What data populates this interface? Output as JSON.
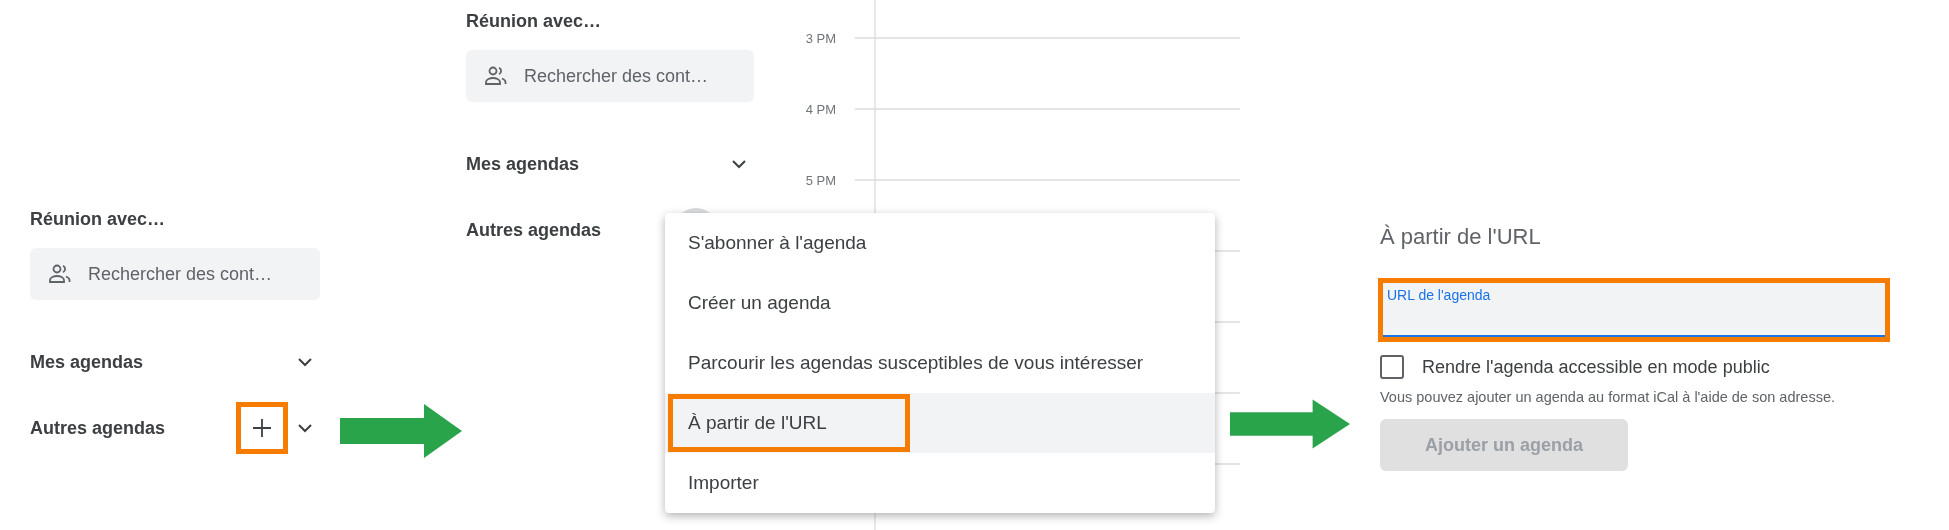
{
  "panel_1": {
    "section_title": "Réunion avec…",
    "search": {
      "placeholder": "Rechercher des cont…"
    },
    "calendar_groups": [
      {
        "label": "Mes agendas",
        "chevron": true
      },
      {
        "label": "Autres agendas",
        "chevron": true,
        "add_button": {
          "kind": "plus",
          "highlighted": true
        }
      }
    ]
  },
  "panel_2": {
    "section_title": "Réunion avec…",
    "search": {
      "placeholder": "Rechercher des cont…"
    },
    "calendar_groups": [
      {
        "label": "Mes agendas",
        "chevron": true
      },
      {
        "label": "Autres agendas",
        "add_button": {
          "kind": "hover"
        }
      }
    ],
    "time_labels": [
      "3 PM",
      "4 PM",
      "5 PM"
    ],
    "menu": {
      "items": [
        {
          "label": "S'abonner à l'agenda",
          "selected": false,
          "highlighted": false
        },
        {
          "label": "Créer un agenda",
          "selected": false,
          "highlighted": false
        },
        {
          "label": "Parcourir les agendas susceptibles de vous intéresser",
          "selected": false,
          "highlighted": false
        },
        {
          "label": "À partir de l'URL",
          "selected": true,
          "highlighted": true
        },
        {
          "label": "Importer",
          "selected": false,
          "highlighted": false
        }
      ]
    }
  },
  "panel_3": {
    "title": "À partir de l'URL",
    "url_field": {
      "label": "URL de l'agenda",
      "focused": true,
      "highlighted": true
    },
    "public_checkbox": {
      "label": "Rendre l'agenda accessible en mode public",
      "checked": false
    },
    "helper_text": "Vous pouvez ajouter un agenda au format iCal à l'aide de son adresse.",
    "add_button": {
      "label": "Ajouter un agenda",
      "disabled": true
    }
  }
}
